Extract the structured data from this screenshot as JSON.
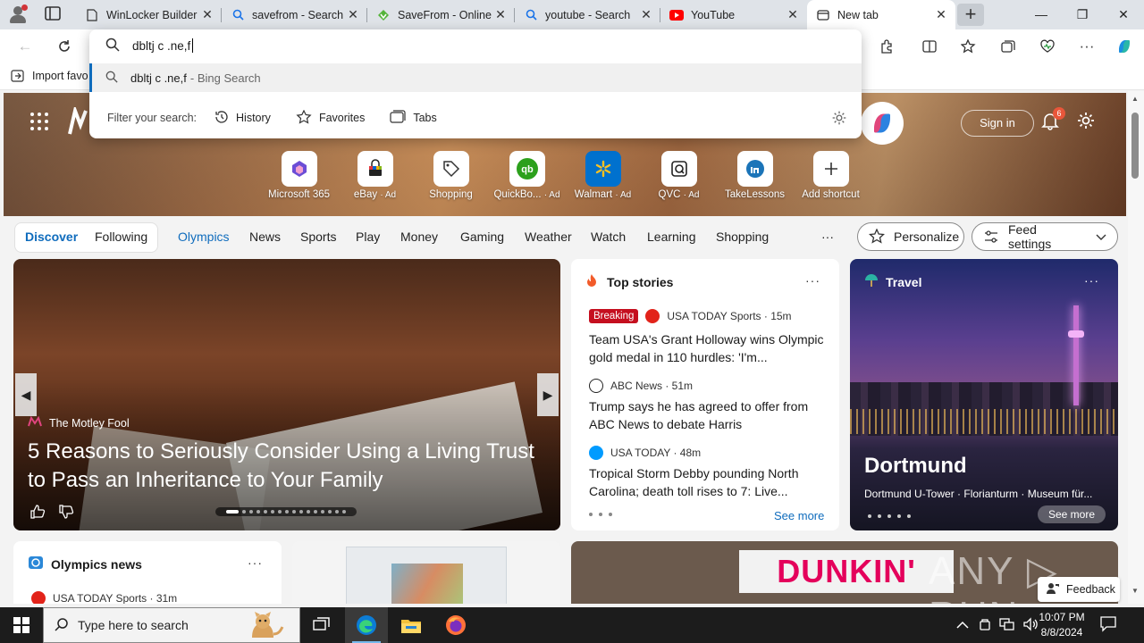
{
  "browser": {
    "tabs": [
      {
        "title": "WinLocker Builder",
        "icon": "document-icon",
        "active": false
      },
      {
        "title": "savefrom - Search",
        "icon": "search-icon",
        "active": false
      },
      {
        "title": "SaveFrom - Online",
        "icon": "savefrom-icon",
        "active": false
      },
      {
        "title": "youtube - Search",
        "icon": "search-icon",
        "active": false
      },
      {
        "title": "YouTube",
        "icon": "youtube-icon",
        "active": false
      },
      {
        "title": "New tab",
        "icon": "newtab-icon",
        "active": true
      }
    ],
    "close_glyph": "✕",
    "new_tab_glyph": "+",
    "window_controls": {
      "minimize": "—",
      "maximize": "❐",
      "close": "✕"
    },
    "bookmarks": {
      "import_label": "Import favo"
    }
  },
  "omnibox": {
    "input_value": "dbltj c .ne,f",
    "suggestion": {
      "query": "dbltj c .ne,f",
      "suffix": "- Bing Search"
    },
    "filter_label": "Filter your search:",
    "filters": [
      {
        "label": "History",
        "icon": "history-icon"
      },
      {
        "label": "Favorites",
        "icon": "star-icon"
      },
      {
        "label": "Tabs",
        "icon": "tabs-icon"
      }
    ]
  },
  "newtab": {
    "sign_in": "Sign in",
    "notification_count": "6",
    "shortcuts": [
      {
        "label": "Microsoft 365",
        "ad": "",
        "color": "#6b4dd6"
      },
      {
        "label": "eBay",
        "ad": "· Ad",
        "color": "#0064d2"
      },
      {
        "label": "Shopping",
        "ad": "",
        "color": "#333333"
      },
      {
        "label": "QuickBo...",
        "ad": "· Ad",
        "color": "#2ca01c"
      },
      {
        "label": "Walmart",
        "ad": "· Ad",
        "color": "#0071ce"
      },
      {
        "label": "QVC",
        "ad": "· Ad",
        "color": "#1a1a1a"
      },
      {
        "label": "TakeLessons",
        "ad": "",
        "color": "#1b74b8"
      },
      {
        "label": "Add shortcut",
        "ad": "",
        "color": "#444444"
      }
    ],
    "nav": {
      "discover": "Discover",
      "following": "Following",
      "items": [
        "Olympics",
        "News",
        "Sports",
        "Play",
        "Money",
        "Gaming",
        "Weather",
        "Watch",
        "Learning",
        "Shopping"
      ],
      "more": "···",
      "personalize": "Personalize",
      "feed_settings": "Feed settings"
    },
    "hero_card": {
      "source": "The Motley Fool",
      "title": "5 Reasons to Seriously Consider Using a Living Trust to Pass an Inheritance to Your Family"
    },
    "top_stories": {
      "heading": "Top stories",
      "more": "···",
      "stories": [
        {
          "badge": "Breaking",
          "source": "USA TODAY Sports · 15m",
          "title": "Team USA's Grant Holloway wins Olympic gold medal in 110 hurdles: 'I'm..."
        },
        {
          "badge": "",
          "source": "ABC News · 51m",
          "title": "Trump says he has agreed to offer from ABC News to debate Harris"
        },
        {
          "badge": "",
          "source": "USA TODAY · 48m",
          "title": "Tropical Storm Debby pounding North Carolina; death toll rises to 7: Live..."
        }
      ],
      "see_more": "See more"
    },
    "travel": {
      "heading": "Travel",
      "more": "···",
      "title": "Dortmund",
      "subtitle": "Dortmund U-Tower · Florianturm · Museum für...",
      "see_more": "See more"
    },
    "olympics_news": {
      "heading": "Olympics news",
      "more": "···",
      "source": "USA TODAY Sports · 31m"
    },
    "dunkin_sign": "DUNKIN'",
    "watermark": "ANY ▷ RUN",
    "feedback": "Feedback"
  },
  "taskbar": {
    "search_placeholder": "Type here to search",
    "time": "10:07 PM",
    "date": "8/8/2024"
  }
}
